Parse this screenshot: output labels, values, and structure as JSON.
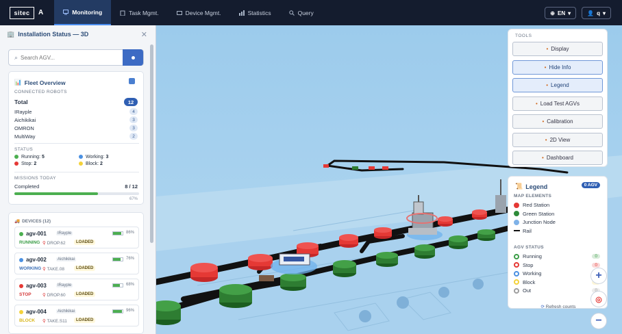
{
  "brand": {
    "logo": "sitec",
    "letter": "A"
  },
  "nav": [
    {
      "label": "Monitoring",
      "icon": "monitor-icon"
    },
    {
      "label": "Task Mgmt.",
      "icon": "clipboard-icon"
    },
    {
      "label": "Device Mgmt.",
      "icon": "device-icon"
    },
    {
      "label": "Statistics",
      "icon": "chart-icon"
    },
    {
      "label": "Query",
      "icon": "search-icon"
    }
  ],
  "top_right": {
    "language": "EN",
    "user": "q"
  },
  "panel": {
    "title": "Installation Status — 3D",
    "search_placeholder": "Search AGV...",
    "fleet": {
      "title": "Fleet Overview",
      "connected_label": "CONNECTED ROBOTS",
      "total_label": "Total",
      "total": "12",
      "vendors": [
        {
          "name": "IRayple",
          "count": "4"
        },
        {
          "name": "Aichikikai",
          "count": "3"
        },
        {
          "name": "OMRON",
          "count": "3"
        },
        {
          "name": "MultiWay",
          "count": "2"
        }
      ],
      "status_label": "STATUS",
      "status": [
        {
          "label": "Running:",
          "value": "5",
          "color": "#4caf50"
        },
        {
          "label": "Working:",
          "value": "3",
          "color": "#4a90e2"
        },
        {
          "label": "Stop:",
          "value": "2",
          "color": "#e53935"
        },
        {
          "label": "Block:",
          "value": "2",
          "color": "#f4d23a"
        }
      ],
      "missions_label": "MISSIONS TODAY",
      "completed_label": "Completed",
      "completed": "8 / 12",
      "completed_pct": "67%",
      "completed_fraction": 0.67
    },
    "devices": {
      "title": "DEVICES (12)",
      "items": [
        {
          "id": "agv-001",
          "vendor": "IRayple",
          "battery_pct": "86%",
          "battery": 0.86,
          "state": "RUNNING",
          "state_color": "#3b9d47",
          "dest": "DROP.62",
          "load": "LOADED",
          "dot": "#4caf50"
        },
        {
          "id": "agv-002",
          "vendor": "Aichikikai",
          "battery_pct": "76%",
          "battery": 0.76,
          "state": "WORKING",
          "state_color": "#3b6fb6",
          "dest": "TAKE.08",
          "load": "LOADED",
          "dot": "#4a90e2"
        },
        {
          "id": "agv-003",
          "vendor": "IRayple",
          "battery_pct": "68%",
          "battery": 0.68,
          "state": "STOP",
          "state_color": "#d43a3a",
          "dest": "DROP.60",
          "load": "LOADED",
          "dot": "#e53935"
        },
        {
          "id": "agv-004",
          "vendor": "Aichikikai",
          "battery_pct": "96%",
          "battery": 0.96,
          "state": "BLOCK",
          "state_color": "#d8b61a",
          "dest": "TAKE.S11",
          "load": "LOADED",
          "dot": "#f4d23a"
        }
      ]
    }
  },
  "tools": {
    "title": "TOOLS",
    "items": [
      {
        "label": "Display",
        "icon": "palette-icon",
        "active": false
      },
      {
        "label": "Hide Info",
        "icon": "info-icon",
        "active": true
      },
      {
        "label": "Legend",
        "icon": "legend-icon",
        "active": true
      },
      {
        "label": "Load Test AGVs",
        "icon": "check-icon",
        "active": false
      },
      {
        "label": "Calibration",
        "icon": "gear-icon",
        "active": false
      },
      {
        "label": "2D View",
        "icon": "map-icon",
        "active": false
      },
      {
        "label": "Dashboard",
        "icon": "house-icon",
        "active": false
      }
    ]
  },
  "legend": {
    "title": "Legend",
    "badge": "0 AGV",
    "map_label": "MAP ELEMENTS",
    "map_items": [
      {
        "label": "Red Station",
        "color": "#e53935"
      },
      {
        "label": "Green Station",
        "color": "#2e8b3a"
      },
      {
        "label": "Junction Node",
        "color": "#7fb2e8"
      },
      {
        "label": "Rail",
        "color": "#111111"
      }
    ],
    "agv_label": "AGV STATUS",
    "agv_items": [
      {
        "label": "Running",
        "count": "0",
        "color": "#3b9d47"
      },
      {
        "label": "Stop",
        "count": "0",
        "color": "#e53935"
      },
      {
        "label": "Working",
        "count": "0",
        "color": "#4a90e2"
      },
      {
        "label": "Block",
        "count": "0",
        "color": "#f4d23a"
      },
      {
        "label": "Out",
        "count": "0",
        "color": "#9e9e9e"
      }
    ],
    "refresh": "Refresh counts"
  }
}
